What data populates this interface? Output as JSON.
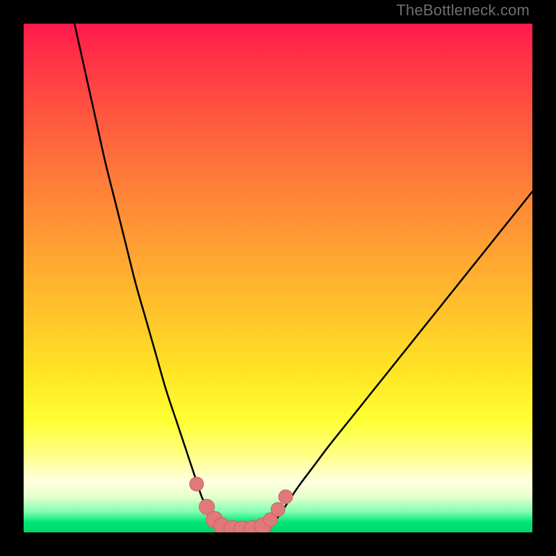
{
  "watermark": "TheBottleneck.com",
  "colors": {
    "background": "#000000",
    "gradient_top": "#ff1a4d",
    "gradient_mid": "#ffff33",
    "gradient_bottom": "#00e676",
    "curve": "#000000",
    "marker_fill": "#e07a7a",
    "marker_stroke": "#c76060"
  },
  "chart_data": {
    "type": "line",
    "title": "",
    "xlabel": "",
    "ylabel": "",
    "xlim": [
      0,
      100
    ],
    "ylim": [
      0,
      100
    ],
    "grid": false,
    "legend": null,
    "series": [
      {
        "name": "bottleneck-curve-left",
        "x": [
          10,
          12,
          14,
          16,
          18,
          20,
          22,
          24,
          26,
          28,
          30,
          32,
          33,
          34,
          35,
          36,
          37,
          38
        ],
        "values": [
          100,
          91,
          82,
          73,
          65,
          57,
          49,
          42,
          35,
          28,
          22,
          16,
          13,
          10,
          7,
          5,
          3,
          1
        ]
      },
      {
        "name": "bottleneck-curve-flat",
        "x": [
          38,
          40,
          42,
          44,
          46,
          48
        ],
        "values": [
          1,
          0.5,
          0.3,
          0.3,
          0.5,
          1
        ]
      },
      {
        "name": "bottleneck-curve-right",
        "x": [
          48,
          50,
          52,
          54,
          57,
          60,
          64,
          68,
          72,
          76,
          80,
          84,
          88,
          92,
          96,
          100
        ],
        "values": [
          1,
          3,
          6,
          9,
          13,
          17,
          22,
          27,
          32,
          37,
          42,
          47,
          52,
          57,
          62,
          67
        ]
      }
    ],
    "markers": {
      "name": "highlight-dots",
      "x": [
        34.0,
        36.0,
        37.5,
        39.0,
        41.0,
        43.0,
        45.0,
        47.0,
        48.5,
        50.0,
        51.5
      ],
      "values": [
        9.5,
        5.0,
        2.5,
        1.2,
        0.7,
        0.6,
        0.7,
        1.2,
        2.5,
        4.5,
        7.0
      ],
      "size": [
        10,
        11,
        12,
        12,
        12,
        12,
        12,
        12,
        10,
        10,
        10
      ]
    }
  }
}
